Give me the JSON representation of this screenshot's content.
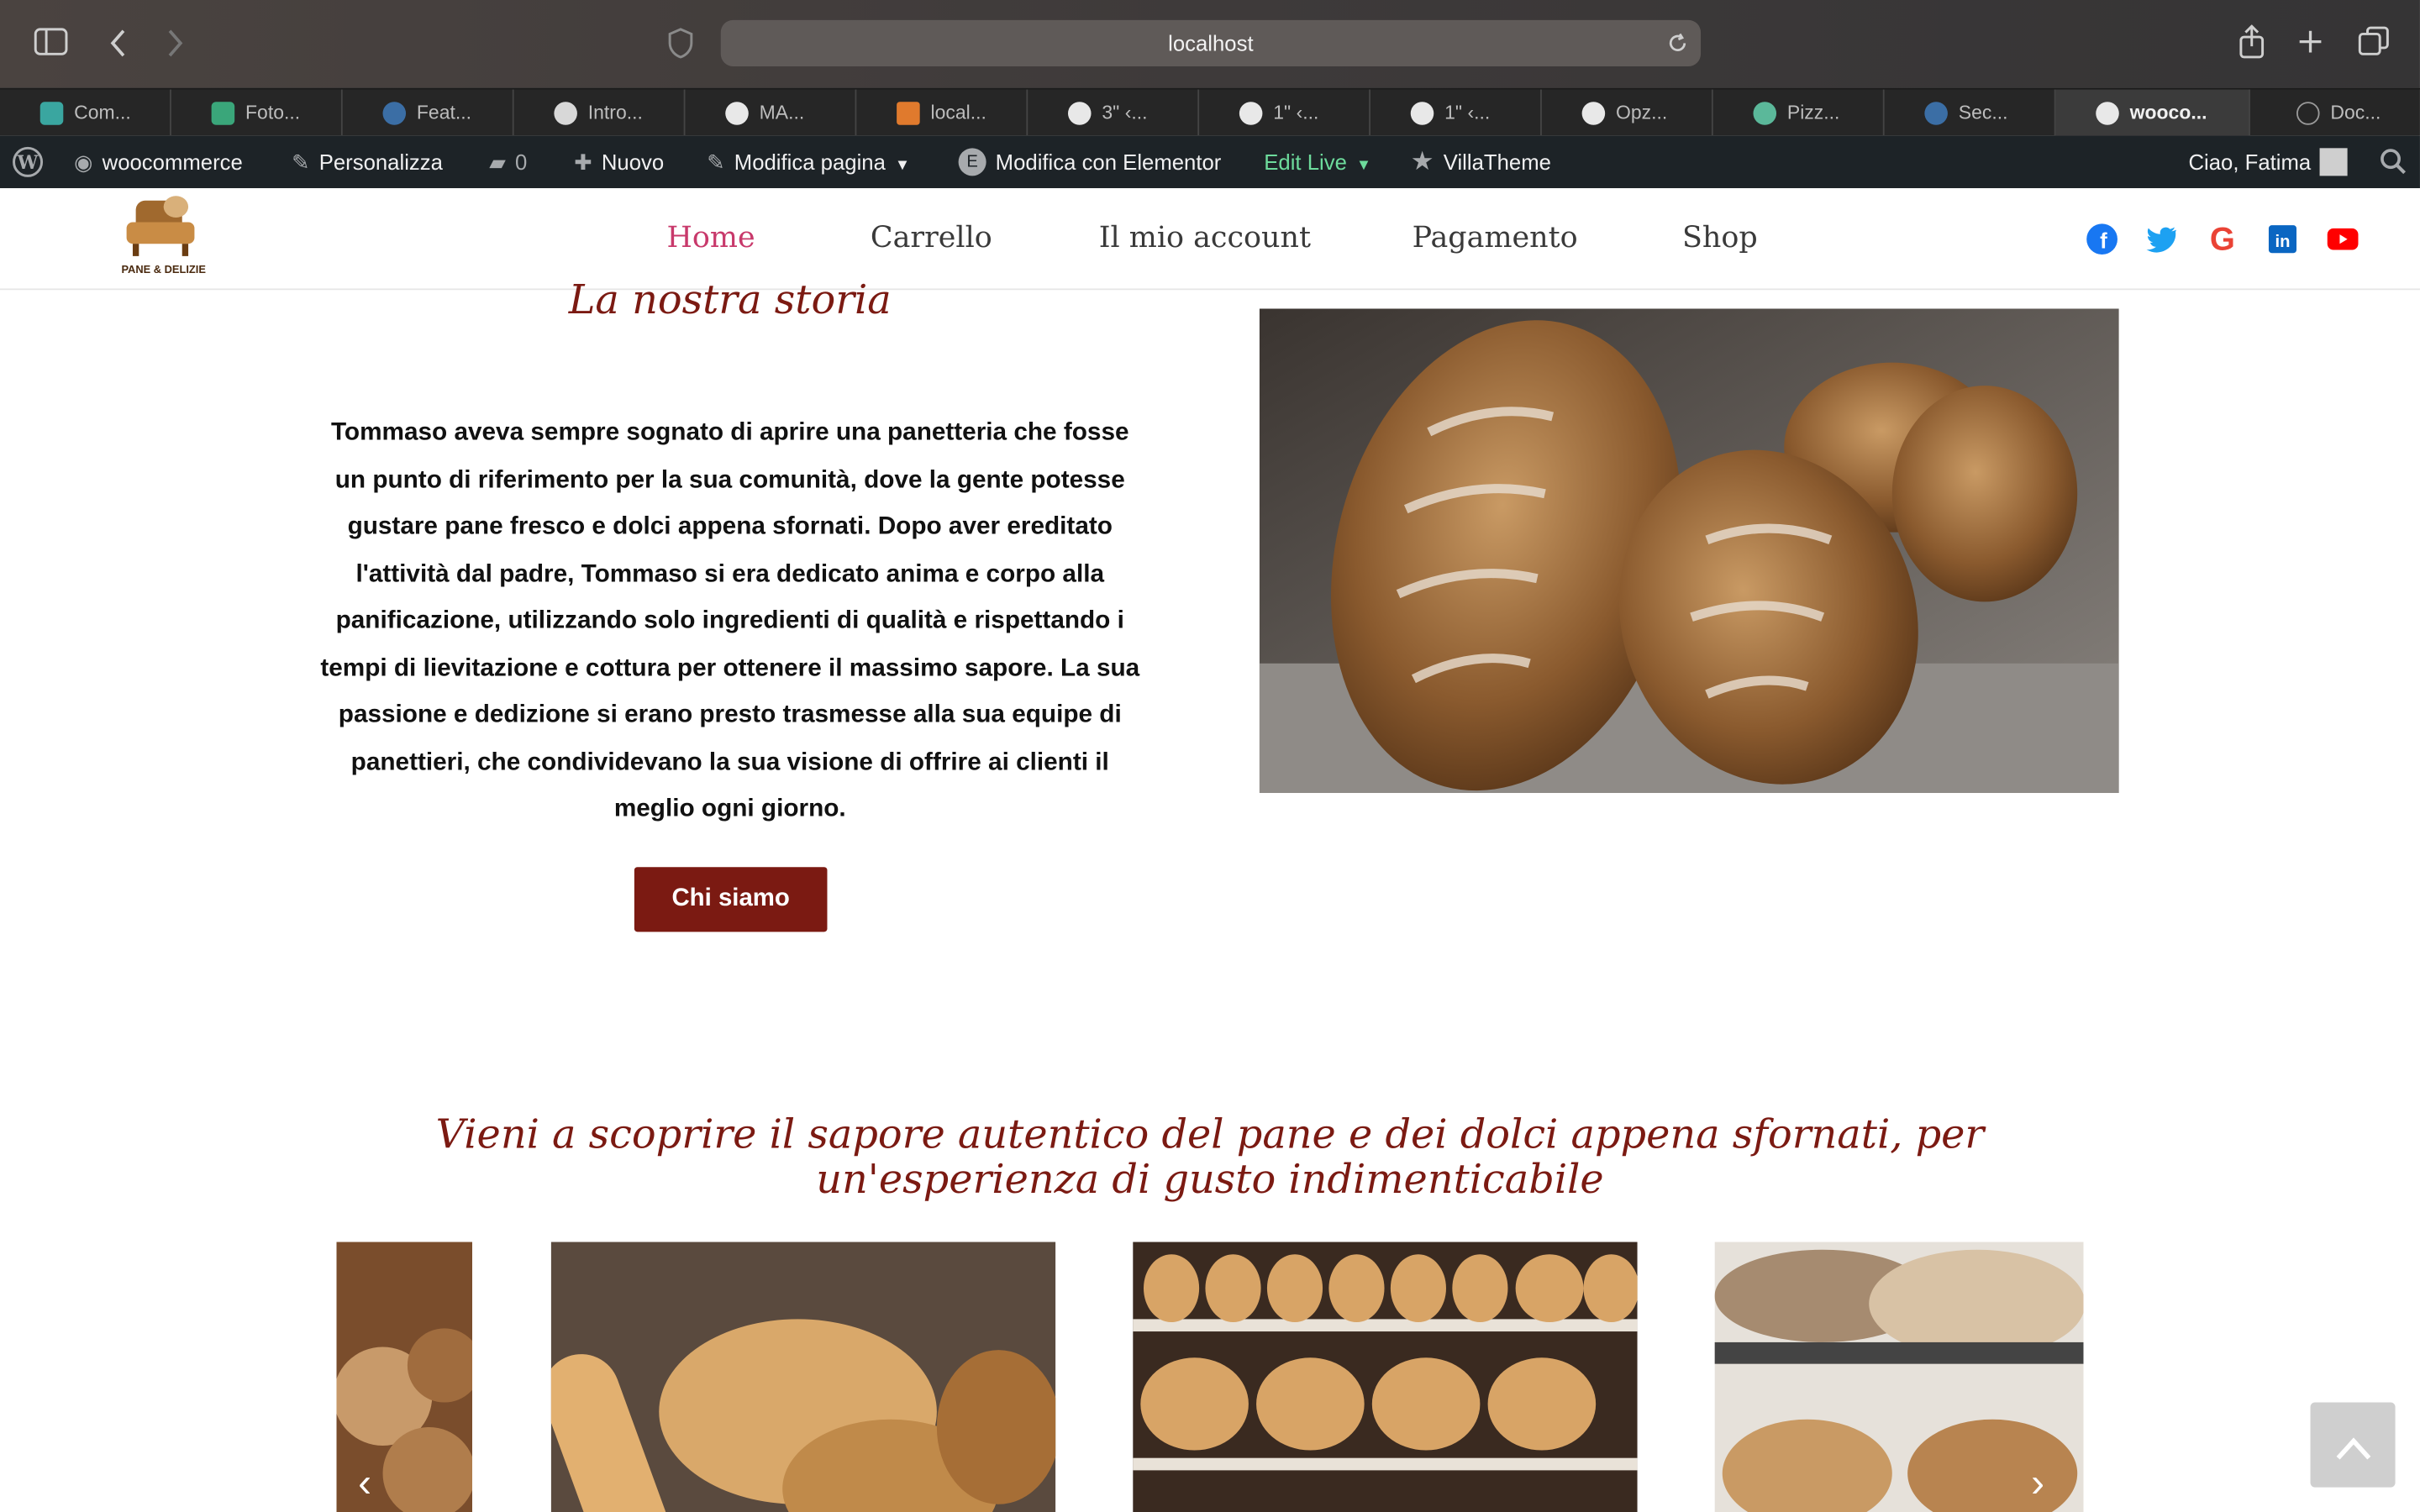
{
  "browser": {
    "url": "localhost",
    "tabs": [
      "Com...",
      "Foto...",
      "Feat...",
      "Intro...",
      "MA...",
      "local...",
      "3\" ‹...",
      "1\" ‹...",
      "1\" ‹...",
      "Opz...",
      "Pizz...",
      "Sec...",
      "wooco...",
      "Doc..."
    ],
    "active_tab_index": 12
  },
  "adminbar": {
    "site": "woocommerce",
    "customize": "Personalizza",
    "comments": "0",
    "new": "Nuovo",
    "edit_page": "Modifica pagina",
    "elementor": "Modifica con Elementor",
    "edit_live": "Edit Live",
    "villatheme": "VillaTheme",
    "greeting": "Ciao, Fatima"
  },
  "header": {
    "logo_text": "PANE & DELIZIE",
    "nav": [
      "Home",
      "Carrello",
      "Il mio account",
      "Pagamento",
      "Shop"
    ],
    "active_nav": "Home",
    "social": [
      "facebook-icon",
      "twitter-icon",
      "google-icon",
      "linkedin-icon",
      "youtube-icon"
    ]
  },
  "story": {
    "title": "La nostra storia",
    "text": "Tommaso aveva sempre sognato di aprire una panetteria che fosse un punto di riferimento per la sua comunità, dove la gente potesse gustare pane fresco e dolci appena sfornati. Dopo aver ereditato l'attività dal padre, Tommaso si era dedicato anima e corpo alla panificazione, utilizzando solo ingredienti di qualità e rispettando i tempi di lievitazione e cottura per ottenere il massimo sapore. La sua passione e dedizione si erano presto trasmesse alla sua equipe di panettieri, che condividevano la sua visione di offrire ai clienti il meglio ogni giorno.",
    "button": "Chi siamo"
  },
  "tagline": "Vieni a scoprire il sapore autentico del pane e dei dolci appena sfornati, per un'esperienza di gusto indimenticabile",
  "colors": {
    "accent": "#7b1a12",
    "nav_active": "#c8396b",
    "adminbar": "#1d2327"
  }
}
